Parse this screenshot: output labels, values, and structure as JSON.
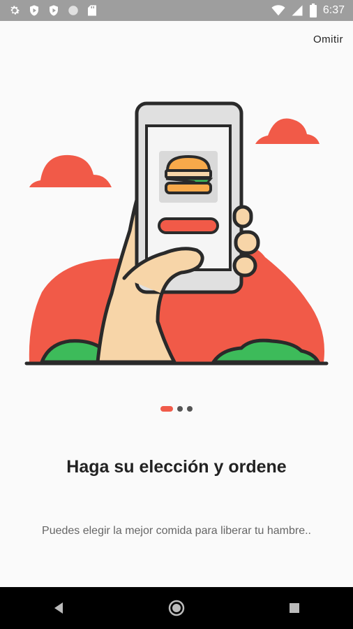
{
  "status_bar": {
    "time": "6:37",
    "left_icons": [
      "settings-icon",
      "shield-play-icon",
      "shield-play-icon",
      "circle-icon",
      "sd-card-icon"
    ],
    "right_icons": [
      "wifi-icon",
      "signal-icon",
      "battery-icon"
    ]
  },
  "header": {
    "skip_label": "Omitir"
  },
  "onboarding": {
    "title": "Haga su elección y ordene",
    "description": "Puedes elegir la mejor comida para liberar tu hambre..",
    "page_index": 0,
    "page_count": 3,
    "illustration": "hand-holding-phone-with-burger"
  },
  "colors": {
    "accent": "#f05b4a",
    "green": "#3dbb5a",
    "skin": "#f7d5a8",
    "outline": "#2a2a2a"
  },
  "nav_bar": {
    "buttons": [
      "back-icon",
      "home-icon",
      "recents-icon"
    ]
  }
}
